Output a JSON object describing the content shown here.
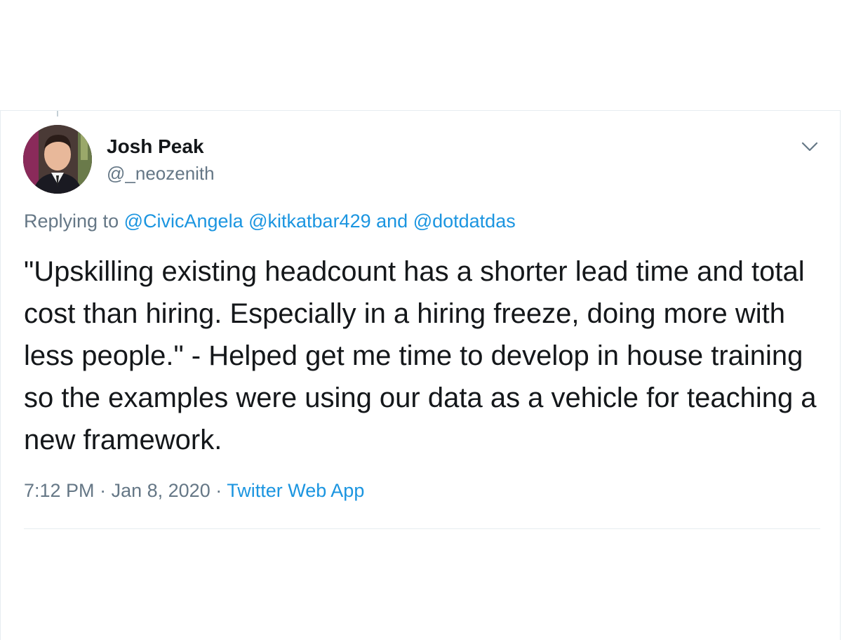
{
  "author": {
    "name": "Josh Peak",
    "handle": "@_neozenith"
  },
  "reply": {
    "prefix": "Replying to",
    "mentions": [
      "@CivicAngela",
      "@kitkatbar429"
    ],
    "conjunction": "and",
    "last_mention": "@dotdatdas"
  },
  "tweet": {
    "text": "\"Upskilling existing headcount has a shorter lead time and total cost than hiring. Especially in a hiring freeze, doing more with less people.\" - Helped get me time to develop in house training so the examples were using our data as a vehicle for teaching a new framework."
  },
  "meta": {
    "time": "7:12 PM",
    "separator": "·",
    "date": "Jan 8, 2020",
    "source": "Twitter Web App"
  },
  "icons": {
    "menu": "chevron-down-icon",
    "avatar": "profile-photo"
  },
  "colors": {
    "link": "#1b95e0",
    "secondary_text": "#657786",
    "primary_text": "#14171a",
    "border": "#e6ecf0"
  }
}
